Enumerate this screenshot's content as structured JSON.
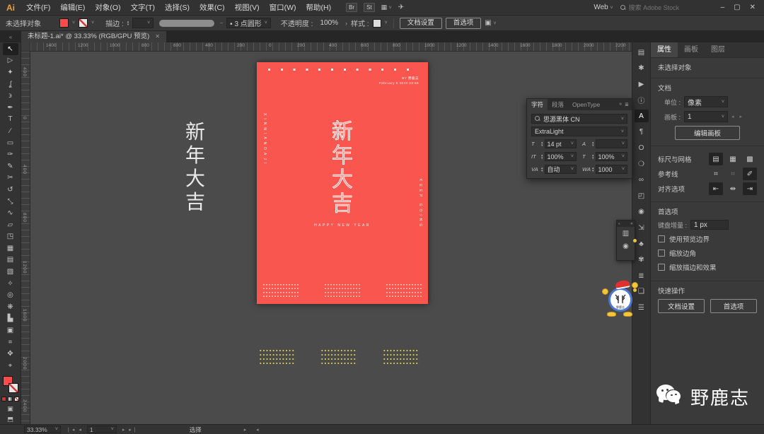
{
  "menu_bar": {
    "logo": "Ai",
    "menus": [
      "文件(F)",
      "编辑(E)",
      "对象(O)",
      "文字(T)",
      "选择(S)",
      "效果(C)",
      "视图(V)",
      "窗口(W)",
      "帮助(H)"
    ],
    "bridge_badge": "Br",
    "stock_badge": "St",
    "layout_icon": "▦",
    "share_icon": "✈",
    "workspace_label": "Web",
    "search_placeholder": "搜索 Adobe Stock",
    "minimize": "–",
    "maximize": "▢",
    "close": "✕"
  },
  "control_bar": {
    "no_selection": "未选择对象",
    "stroke_label": "描边 :",
    "brush_value": "• 3 点圆形",
    "opacity_label": "不透明度 :",
    "opacity_value": "100%",
    "opacity_chevron": "›",
    "style_label": "样式 :",
    "document_setup": "文档设置",
    "preferences": "首选项",
    "isolate_icon": "▣"
  },
  "document_tab": {
    "title": "未标题-1.ai* @ 33.33% (RGB/GPU 预览)",
    "close": "✕",
    "collapse": "«"
  },
  "rulers": {
    "top": [
      "1400",
      "1200",
      "1000",
      "800",
      "600",
      "400",
      "200",
      "0",
      "200",
      "400",
      "600",
      "800",
      "1000",
      "1200",
      "1400",
      "1600",
      "1800",
      "2000",
      "2200"
    ],
    "left": [
      "400",
      "0",
      "400",
      "800",
      "1200",
      "1600",
      "2000",
      "2400"
    ]
  },
  "toolbar": {
    "tools": [
      {
        "name": "selection",
        "glyph": "↖"
      },
      {
        "name": "direct-selection",
        "glyph": "▷"
      },
      {
        "name": "magic-wand",
        "glyph": "✦"
      },
      {
        "name": "lasso",
        "glyph": "ʆ"
      },
      {
        "name": "curvature",
        "glyph": "϶"
      },
      {
        "name": "pen",
        "glyph": "✒"
      },
      {
        "name": "type",
        "glyph": "T"
      },
      {
        "name": "line-segment",
        "glyph": "∕"
      },
      {
        "name": "rectangle",
        "glyph": "▭"
      },
      {
        "name": "paintbrush",
        "glyph": "✑"
      },
      {
        "name": "pencil",
        "glyph": "✎"
      },
      {
        "name": "scissors",
        "glyph": "✂"
      },
      {
        "name": "rotate",
        "glyph": "↺"
      },
      {
        "name": "scale",
        "glyph": "⤡"
      },
      {
        "name": "width",
        "glyph": "∿"
      },
      {
        "name": "free-transform",
        "glyph": "▱"
      },
      {
        "name": "shape-builder",
        "glyph": "◳"
      },
      {
        "name": "perspective-grid",
        "glyph": "▦"
      },
      {
        "name": "mesh",
        "glyph": "▤"
      },
      {
        "name": "gradient",
        "glyph": "▧"
      },
      {
        "name": "eyedropper",
        "glyph": "✧"
      },
      {
        "name": "blend",
        "glyph": "◎"
      },
      {
        "name": "symbol-sprayer",
        "glyph": "❋"
      },
      {
        "name": "column-graph",
        "glyph": "▙"
      },
      {
        "name": "artboard",
        "glyph": "▣"
      },
      {
        "name": "slice",
        "glyph": "⌗"
      },
      {
        "name": "hand",
        "glyph": "✥"
      },
      {
        "name": "zoom",
        "glyph": "⌖"
      }
    ]
  },
  "poster": {
    "bg_color": "#f8564e",
    "byline": "BY 野鹿志",
    "date": "February 5 2020 23:59",
    "title_chars": [
      "新",
      "年",
      "大",
      "吉"
    ],
    "subtitle": "HAPPY NEW YEAR",
    "left_vertical": "XINNIANDAJI",
    "right_vertical": "KEEP GOING"
  },
  "pasteboard": {
    "side_title_chars": [
      "新",
      "年",
      "大",
      "吉"
    ],
    "accent_yellow": "#ddcc4f"
  },
  "character_panel": {
    "tabs": [
      "字符",
      "段落",
      "OpenType"
    ],
    "head_more": "»",
    "head_menu": "≣",
    "font_name": "思源黑体 CN",
    "font_style": "ExtraLight",
    "icons": {
      "size": "T",
      "leading": "A",
      "vscale": "IT",
      "hscale": "T",
      "kerning": "VA",
      "tracking": "WA"
    },
    "size_value": "14 pt",
    "leading_value": "",
    "vscale_value": "100%",
    "hscale_value": "100%",
    "kerning_value": "自动",
    "tracking_value": "1000"
  },
  "float_panel": {
    "collapse": "«",
    "close": "✕",
    "icons": [
      "▥",
      "◉"
    ]
  },
  "dock": {
    "icons": [
      {
        "name": "libraries",
        "glyph": "▤"
      },
      {
        "name": "actions",
        "glyph": "✱"
      },
      {
        "name": "quick-play",
        "glyph": "▶"
      },
      {
        "name": "info",
        "glyph": "ⓘ"
      },
      {
        "name": "character",
        "glyph": "A"
      },
      {
        "name": "paragraph",
        "glyph": "¶"
      },
      {
        "name": "opentype",
        "glyph": "O"
      },
      {
        "name": "cc-libraries",
        "glyph": "❍"
      },
      {
        "name": "links",
        "glyph": "∞"
      },
      {
        "name": "navigator",
        "glyph": "◰"
      },
      {
        "name": "appearance",
        "glyph": "◉"
      },
      {
        "name": "export",
        "glyph": "⇲"
      },
      {
        "name": "symbols",
        "glyph": "♣"
      },
      {
        "name": "brushes",
        "glyph": "✾"
      },
      {
        "name": "align",
        "glyph": "≣"
      },
      {
        "name": "layers",
        "glyph": "❏"
      },
      {
        "name": "panel-menu",
        "glyph": "☰"
      }
    ]
  },
  "right_panel": {
    "tabs": [
      "属性",
      "画板",
      "图层"
    ],
    "no_selection": "未选择对象",
    "doc_section": "文档",
    "unit_label": "单位 :",
    "unit_value": "像素",
    "artboard_label": "画板 :",
    "artboard_value": "1",
    "artboard_arrows": "◂ ▸",
    "edit_artboard_btn": "编辑画板",
    "ruler_grid_label": "标尺与网格",
    "ruler_grid_icons": [
      "▤",
      "▦",
      "▩"
    ],
    "guides_label": "参考线",
    "guides_icons": [
      "⌗",
      "⌗",
      "✐"
    ],
    "align_label": "对齐选项",
    "align_icons": [
      "⇤",
      "⇹",
      "⇥"
    ],
    "prefs_section": "首选项",
    "kbd_label": "键盘增量 :",
    "kbd_value": "1 px",
    "checkbox_labels": [
      "使用预览边界",
      "缩放边角",
      "缩放描边和效果"
    ],
    "quick_actions_label": "快速操作",
    "doc_setup_btn": "文档设置",
    "prefs_btn": "首选项"
  },
  "status_bar": {
    "zoom": "33.33%",
    "nav_left": "❘◂ ◂",
    "artboard_number": "1",
    "nav_right": "▸ ▸❘",
    "tool_name": "选择",
    "scroll_arrows": "▸ ◂"
  },
  "watermark": {
    "text": "野鹿志"
  }
}
